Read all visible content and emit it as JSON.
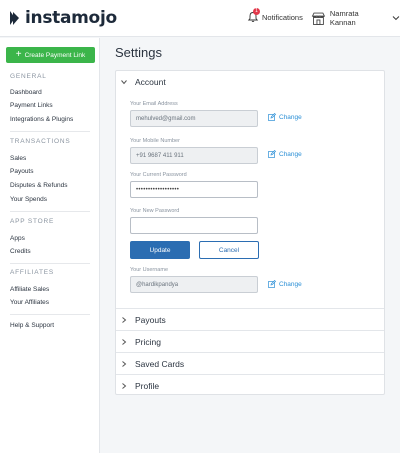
{
  "brand": {
    "name": "instamojo"
  },
  "header": {
    "notifications_label": "Notifications",
    "notifications_count": "1",
    "user_name": "Namrata Kannan"
  },
  "sidebar": {
    "create_button": "Create Payment Link",
    "sections": {
      "general": "GENERAL",
      "transactions": "TRANSACTIONS",
      "app_store": "APP STORE",
      "affiliates": "AFFILIATES"
    },
    "items": {
      "dashboard": "Dashboard",
      "payment_links": "Payment Links",
      "integrations": "Integrations & Plugins",
      "sales": "Sales",
      "payouts": "Payouts",
      "disputes": "Disputes & Refunds",
      "spends": "Your Spends",
      "apps": "Apps",
      "credits": "Credits",
      "affiliate_sales": "Affiliate Sales",
      "your_affiliates": "Your Affiliates",
      "help": "Help & Support"
    }
  },
  "main": {
    "title": "Settings",
    "account": {
      "heading": "Account",
      "email_label": "Your Email Address",
      "email_value": "mehulved@gmail.com",
      "mobile_label": "Your Mobile Number",
      "mobile_value": "+91 9687 411 911",
      "current_password_label": "Your Current Password",
      "current_password_value": "••••••••••••••••••",
      "new_password_label": "Your New Password",
      "new_password_value": "",
      "update_label": "Update",
      "cancel_label": "Cancel",
      "username_label": "Your Username",
      "username_value": "@hardikpandya",
      "change_label": "Change"
    },
    "sections": {
      "payouts": "Payouts",
      "pricing": "Pricing",
      "saved_cards": "Saved Cards",
      "profile": "Profile"
    }
  },
  "colors": {
    "primary": "#2b6db2",
    "success": "#3bb54a",
    "link": "#2b8fd6",
    "badge": "#e2394b"
  }
}
